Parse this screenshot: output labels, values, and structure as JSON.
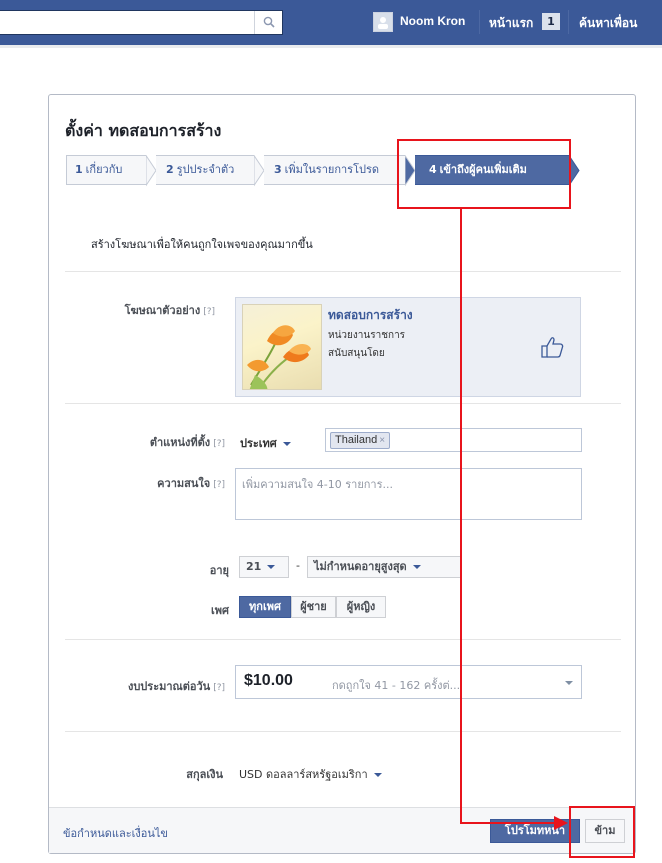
{
  "topbar": {
    "user_name": "Noom Kron",
    "home_label": "หน้าแรก",
    "home_badge": "1",
    "find_friends_label": "ค้นหาเพื่อน"
  },
  "dialog": {
    "title": "ตั้งค่า ทดสอบการสร้าง",
    "steps": [
      {
        "num": "1",
        "label": "เกี่ยวกับ",
        "active": false
      },
      {
        "num": "2",
        "label": "รูปประจำตัว",
        "active": false
      },
      {
        "num": "3",
        "label": "เพิ่มในรายการโปรด",
        "active": false
      },
      {
        "num": "4",
        "label": "เข้าถึงผู้คนเพิ่มเติม",
        "active": true
      }
    ],
    "intro": "สร้างโฆษณาเพื่อให้คนถูกใจเพจของคุณมากขึ้น",
    "help_mark": "[?]",
    "preview": {
      "label": "โฆษณาตัวอย่าง",
      "title": "ทดสอบการสร้าง",
      "line2": "หน่วยงานราชการ",
      "line3": "สนับสนุนโดย"
    },
    "location": {
      "label": "ตำแหน่งที่ตั้ง",
      "scope": "ประเทศ",
      "token": "Thailand"
    },
    "interests": {
      "label": "ความสนใจ",
      "placeholder": "เพิ่มความสนใจ 4-10 รายการ..."
    },
    "age": {
      "label": "อายุ",
      "min": "21",
      "dash": "-",
      "max": "ไม่กำหนดอายุสูงสุด"
    },
    "gender": {
      "label": "เพศ",
      "options": [
        "ทุกเพศ",
        "ผู้ชาย",
        "ผู้หญิง"
      ],
      "selected": "ทุกเพศ"
    },
    "budget": {
      "label": "งบประมาณต่อวัน",
      "amount": "$10.00",
      "note": "กดถูกใจ 41 - 162 ครั้งต่..."
    },
    "currency": {
      "label": "สกุลเงิน",
      "value": "USD ดอลลาร์สหรัฐอเมริกา"
    },
    "footer": {
      "terms": "ข้อกำหนดและเงื่อนไข",
      "promote": "โปรโมทหน้า",
      "skip": "ข้าม"
    }
  },
  "colors": {
    "brand": "#3b5998",
    "annotation": "#e8141c"
  }
}
